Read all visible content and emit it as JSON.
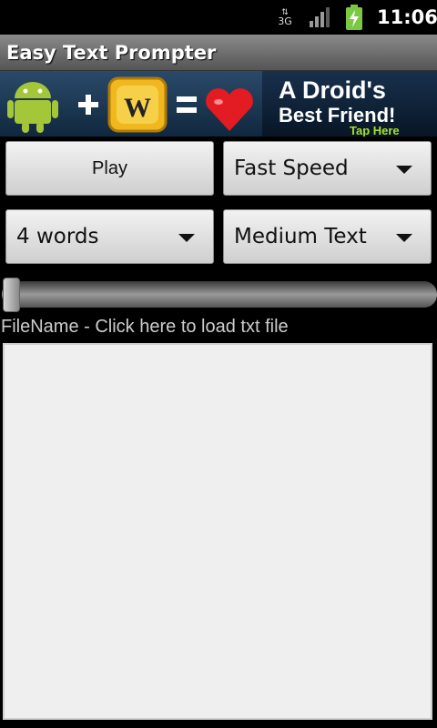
{
  "status_bar": {
    "network_type": "3G",
    "signal_icon": "signal-bars-icon",
    "battery_icon": "battery-charging-icon",
    "time": "11:06"
  },
  "app_bar": {
    "title": "Easy Text Prompter"
  },
  "ad_banner": {
    "line1": "A Droid's",
    "line2": "Best Friend!",
    "line3": "Tap Here",
    "icons": [
      "android-robot-icon",
      "plus-icon",
      "words-tile-icon",
      "equals-icon",
      "heart-icon"
    ],
    "accent_color": "#a6e22e"
  },
  "controls": {
    "play_label": "Play",
    "speed_selected": "Fast Speed",
    "words_selected": "4 words",
    "text_size_selected": "Medium Text"
  },
  "seekbar": {
    "progress": 0
  },
  "file": {
    "label": "FileName - Click here to load txt file"
  },
  "text_area": {
    "content": ""
  }
}
